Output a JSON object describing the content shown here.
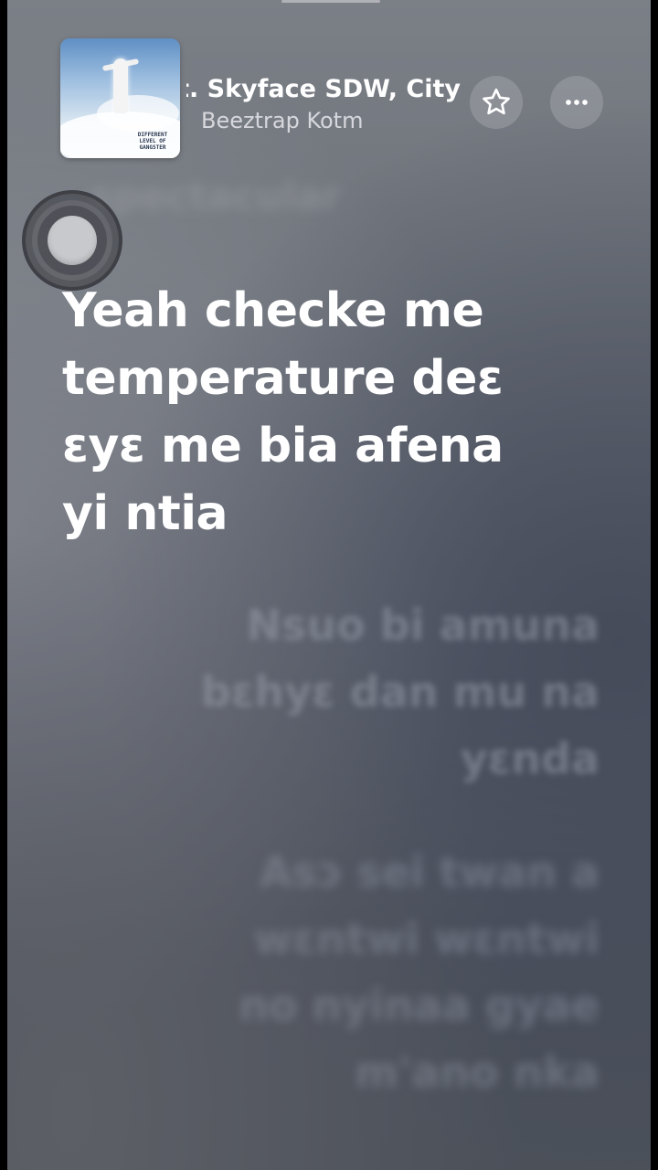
{
  "now_playing": {
    "title": "at. Skyface SDW, City",
    "artist": "Beeztrap Kotm",
    "album_art_text": [
      "DIFFERENT",
      "LEVEL OF",
      "GANGSTER"
    ],
    "favorite_icon": "star-icon",
    "more_icon": "ellipsis-icon"
  },
  "lyrics": {
    "previous": "spectacular",
    "current": [
      "Yeah checke me",
      "temperature deɛ",
      "ɛyɛ me bia afena",
      "yi ntia"
    ],
    "next": [
      [
        "Nsuo bi amuna",
        "bɛhyɛ dan mu na",
        "yɛnda"
      ],
      [
        "Asɔ sei twan a",
        "wɛntwi wɛntwi",
        "no nyinaa gyae",
        "m'ano nka"
      ]
    ]
  },
  "assistive_touch_icon": "assistive-touch-icon"
}
